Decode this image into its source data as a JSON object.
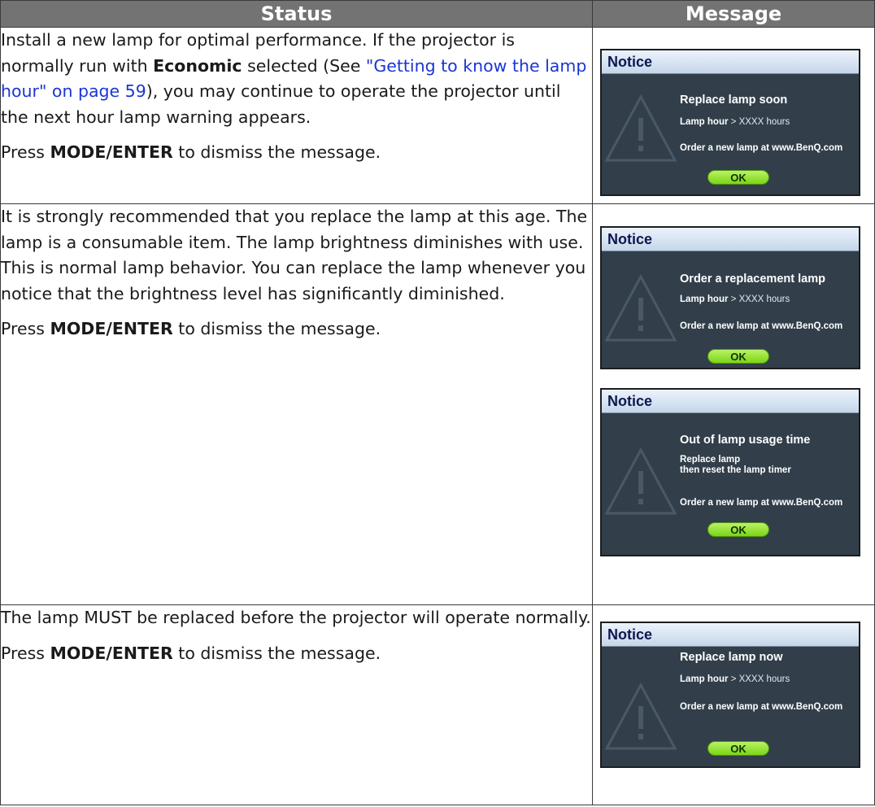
{
  "headers": {
    "status": "Status",
    "message": "Message"
  },
  "rows": [
    {
      "status_paragraph_1": {
        "pre": "Install a new lamp for optimal performance. If the projector is normally run with ",
        "bold": "Economic",
        "mid": " selected (See ",
        "link": "\"Getting to know the lamp hour\" on page 59",
        "post": "), you may continue to operate the projector until the next hour lamp warning appears."
      },
      "press": {
        "pre": "Press ",
        "key": "MODE/ENTER",
        "post": " to dismiss the message."
      },
      "notice": {
        "header": "Notice",
        "title": "Replace lamp soon",
        "hour_label": "Lamp hour",
        "hour_value": "> XXXX hours",
        "order": "Order a new lamp at www.BenQ.com",
        "ok": "OK"
      }
    },
    {
      "status_paragraph_1": "It is strongly recommended that you replace the lamp at this age. The lamp is a consumable item. The lamp brightness diminishes with use. This is normal lamp behavior. You can replace the lamp whenever you notice that the brightness level has significantly diminished.",
      "press": {
        "pre": "Press ",
        "key": "MODE/ENTER",
        "post": " to dismiss the message."
      },
      "notice_a": {
        "header": "Notice",
        "title": "Order a replacement lamp",
        "hour_label": "Lamp hour",
        "hour_value": "> XXXX hours",
        "order": "Order a new lamp at www.BenQ.com",
        "ok": "OK"
      },
      "notice_b": {
        "header": "Notice",
        "title": "Out of lamp usage time",
        "line1": "Replace lamp",
        "line2": "then reset the lamp timer",
        "order": "Order a new lamp at www.BenQ.com",
        "ok": "OK"
      }
    },
    {
      "status_paragraph_1": "The lamp MUST be replaced before the projector will operate normally.",
      "press": {
        "pre": "Press ",
        "key": "MODE/ENTER",
        "post": " to dismiss the message."
      },
      "notice": {
        "header": "Notice",
        "title": "Replace lamp now",
        "hour_label": "Lamp hour",
        "hour_value": "> XXXX hours",
        "order": "Order a new lamp at www.BenQ.com",
        "ok": "OK"
      }
    }
  ],
  "colors": {
    "header_bg": "#737373",
    "link": "#1a35d6",
    "osd_bg": "#323f4a",
    "ok_button": "#9be640"
  },
  "icons": [
    "warning-triangle-icon"
  ]
}
